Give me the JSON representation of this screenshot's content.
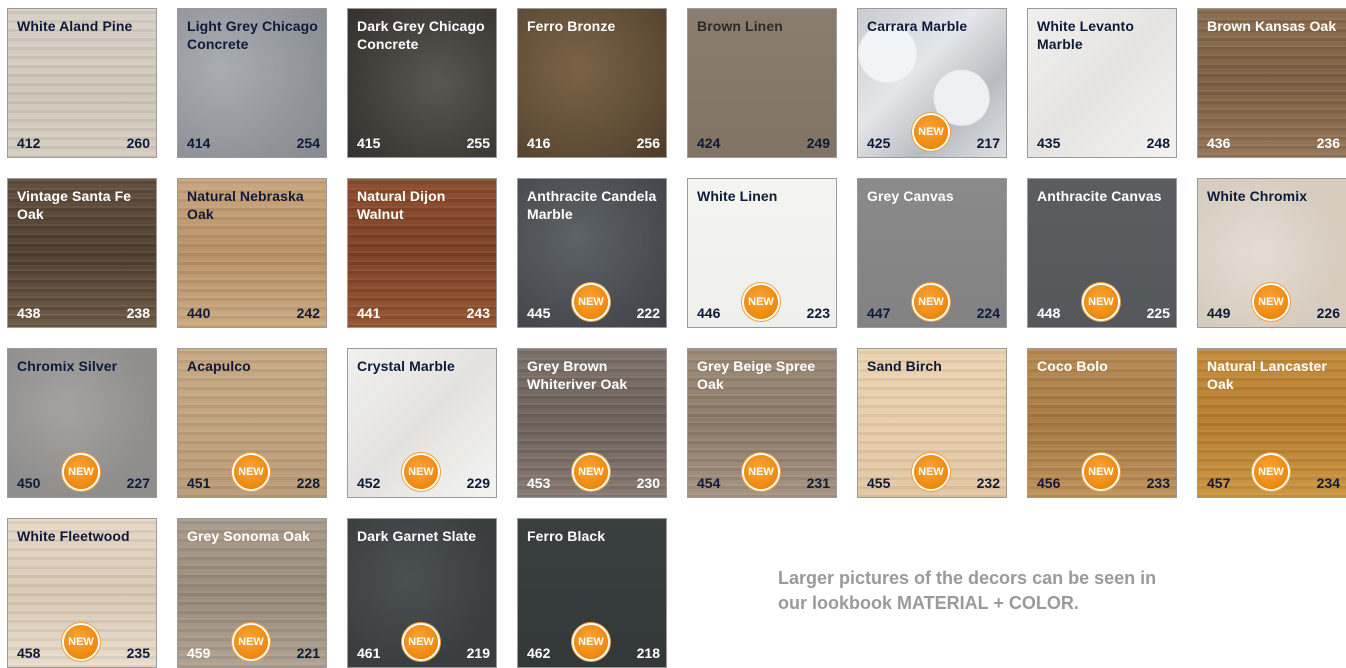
{
  "tiles": [
    {
      "name": "White Aland Pine",
      "code": "412",
      "num": "260",
      "new": false
    },
    {
      "name": "Light Grey Chicago Concrete",
      "code": "414",
      "num": "254",
      "new": false
    },
    {
      "name": "Dark Grey Chicago Concrete",
      "code": "415",
      "num": "255",
      "new": false
    },
    {
      "name": "Ferro Bronze",
      "code": "416",
      "num": "256",
      "new": false
    },
    {
      "name": "Brown Linen",
      "code": "424",
      "num": "249",
      "new": false
    },
    {
      "name": "Carrara Marble",
      "code": "425",
      "num": "217",
      "new": true
    },
    {
      "name": "White Levanto Marble",
      "code": "435",
      "num": "248",
      "new": false
    },
    {
      "name": "Brown Kansas Oak",
      "code": "436",
      "num": "236",
      "new": false
    },
    {
      "name": "Vintage Santa Fe Oak",
      "code": "438",
      "num": "238",
      "new": false
    },
    {
      "name": "Natural Nebraska Oak",
      "code": "440",
      "num": "242",
      "new": false
    },
    {
      "name": "Natural Dijon Walnut",
      "code": "441",
      "num": "243",
      "new": false
    },
    {
      "name": "Anthracite Candela Marble",
      "code": "445",
      "num": "222",
      "new": true
    },
    {
      "name": "White Linen",
      "code": "446",
      "num": "223",
      "new": true
    },
    {
      "name": "Grey Canvas",
      "code": "447",
      "num": "224",
      "new": true
    },
    {
      "name": "Anthracite Canvas",
      "code": "448",
      "num": "225",
      "new": true
    },
    {
      "name": "White Chromix",
      "code": "449",
      "num": "226",
      "new": true
    },
    {
      "name": "Chromix Silver",
      "code": "450",
      "num": "227",
      "new": true
    },
    {
      "name": "Acapulco",
      "code": "451",
      "num": "228",
      "new": true
    },
    {
      "name": "Crystal Marble",
      "code": "452",
      "num": "229",
      "new": true
    },
    {
      "name": "Grey Brown Whiteriver Oak",
      "code": "453",
      "num": "230",
      "new": true
    },
    {
      "name": "Grey Beige Spree Oak",
      "code": "454",
      "num": "231",
      "new": true
    },
    {
      "name": "Sand Birch",
      "code": "455",
      "num": "232",
      "new": true
    },
    {
      "name": "Coco Bolo",
      "code": "456",
      "num": "233",
      "new": true
    },
    {
      "name": "Natural Lancaster Oak",
      "code": "457",
      "num": "234",
      "new": true
    },
    {
      "name": "White Fleetwood",
      "code": "458",
      "num": "235",
      "new": true
    },
    {
      "name": "Grey Sonoma Oak",
      "code": "459",
      "num": "221",
      "new": true
    },
    {
      "name": "Dark Garnet Slate",
      "code": "461",
      "num": "219",
      "new": true
    },
    {
      "name": "Ferro Black",
      "code": "462",
      "num": "218",
      "new": true
    }
  ],
  "badge_label": "NEW",
  "note": {
    "line1": "Larger pictures of the decors can be seen in",
    "line2": "our lookbook MATERIAL + COLOR."
  }
}
